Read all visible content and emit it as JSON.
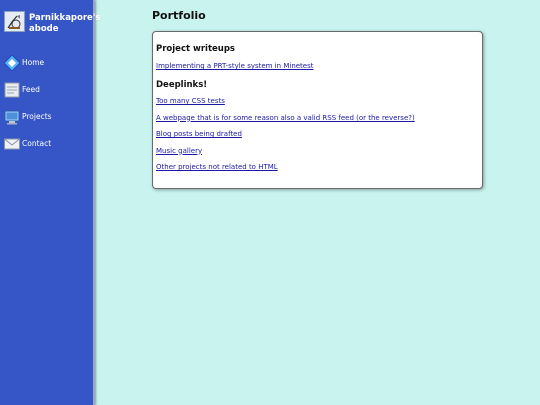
{
  "sidebar": {
    "site_title": "Parnikkapore's abode",
    "logo_icon": "gramophone-logo-icon",
    "items": [
      {
        "label": "Home",
        "icon": "home-diamond-icon"
      },
      {
        "label": "Feed",
        "icon": "feed-document-icon"
      },
      {
        "label": "Projects",
        "icon": "computer-monitor-icon"
      },
      {
        "label": "Contact",
        "icon": "envelope-icon"
      }
    ]
  },
  "main": {
    "title": "Portfolio",
    "sections": [
      {
        "heading": "Project writeups",
        "links": [
          "Implementing a PRT-style system in Minetest"
        ]
      },
      {
        "heading": "Deeplinks!",
        "links": [
          "Too many CSS tests",
          "A webpage that is for some reason also a valid RSS feed (or the reverse?)",
          "Blog posts being drafted",
          "Music gallery",
          "Other projects not related to HTML"
        ]
      }
    ]
  },
  "colors": {
    "sidebar_bg": "#3656c8",
    "page_bg": "#c8f3ee",
    "link": "#1a1aa6"
  }
}
